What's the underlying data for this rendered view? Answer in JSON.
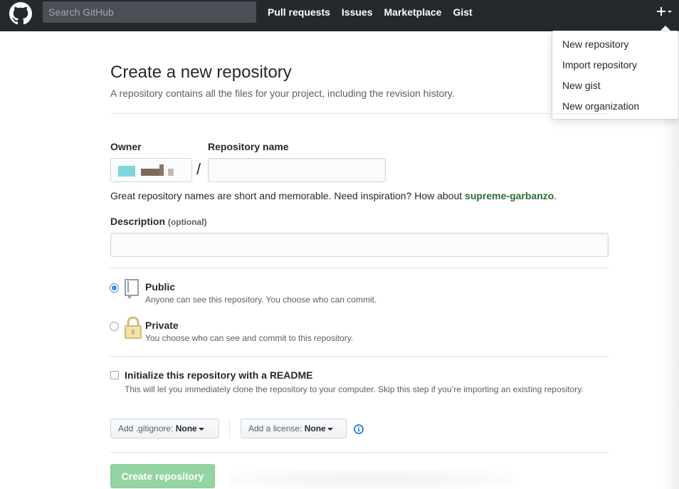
{
  "header": {
    "search_placeholder": "Search GitHub",
    "nav": [
      "Pull requests",
      "Issues",
      "Marketplace",
      "Gist"
    ],
    "logo_icon": "github-octocat-icon",
    "plus_icon": "plus-icon"
  },
  "dropdown": {
    "items": [
      "New repository",
      "Import repository",
      "New gist",
      "New organization"
    ]
  },
  "page": {
    "title": "Create a new repository",
    "subtitle": "A repository contains all the files for your project, including the revision history."
  },
  "form": {
    "owner_label": "Owner",
    "repo_name_label": "Repository name",
    "slash": "/",
    "repo_name_value": "",
    "hint_prefix": "Great repository names are short and memorable. Need inspiration? How about ",
    "hint_suggestion": "supreme-garbanzo",
    "hint_suffix": ".",
    "description_label": "Description",
    "description_optional": "(optional)",
    "description_value": "",
    "visibility": {
      "public_title": "Public",
      "public_desc": "Anyone can see this repository. You choose who can commit.",
      "private_title": "Private",
      "private_desc": "You choose who can see and commit to this repository.",
      "selected": "public"
    },
    "readme": {
      "title": "Initialize this repository with a README",
      "desc": "This will let you immediately clone the repository to your computer. Skip this step if you’re importing an existing repository.",
      "checked": false
    },
    "gitignore_label": "Add .gitignore:",
    "gitignore_value": "None",
    "license_label": "Add a license:",
    "license_value": "None",
    "submit_label": "Create repository"
  },
  "colors": {
    "header_bg": "#24292e",
    "suggestion": "#2c6e2f",
    "radio_selected": "#3b8fe8",
    "submit_disabled": "#94d3a2"
  }
}
